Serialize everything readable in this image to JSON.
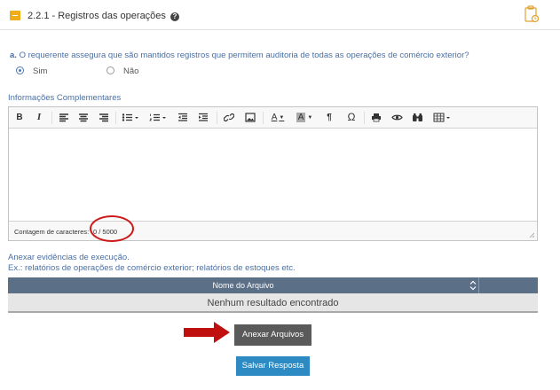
{
  "section": {
    "title": "2.2.1 - Registros das operações",
    "help_glyph": "?"
  },
  "question": {
    "letter": "a.",
    "text": "O requerente assegura que são mantidos registros que permitem auditoria de todas as operações de comércio exterior?",
    "options": [
      {
        "label": "Sim",
        "checked": true
      },
      {
        "label": "Não",
        "checked": false
      }
    ]
  },
  "info": {
    "label": "Informações Complementares"
  },
  "editor": {
    "toolbar": {
      "bold": "B",
      "italic": "I",
      "text_color": "A",
      "bg_color": "A",
      "paragraph": "¶",
      "omega": "Ω"
    },
    "counter_label": "Contagem de caracteres:",
    "counter_value": "0 / 5000"
  },
  "attachments": {
    "label_line1": "Anexar evidências de execução.",
    "label_line2": "Ex.: relatórios de operações de comércio exterior; relatórios de estoques etc.",
    "column_header": "Nome do Arquivo",
    "empty_message": "Nenhum resultado encontrado"
  },
  "buttons": {
    "attach": "Anexar Arquivos",
    "save": "Salvar Resposta"
  },
  "colors": {
    "accent_orange": "#f0ad1a",
    "link_blue": "#4a6fa5",
    "table_header": "#5b6f86",
    "save_button": "#2d8ac3",
    "attach_button": "#5a5a5a",
    "highlight_red": "#cc1a1a"
  }
}
